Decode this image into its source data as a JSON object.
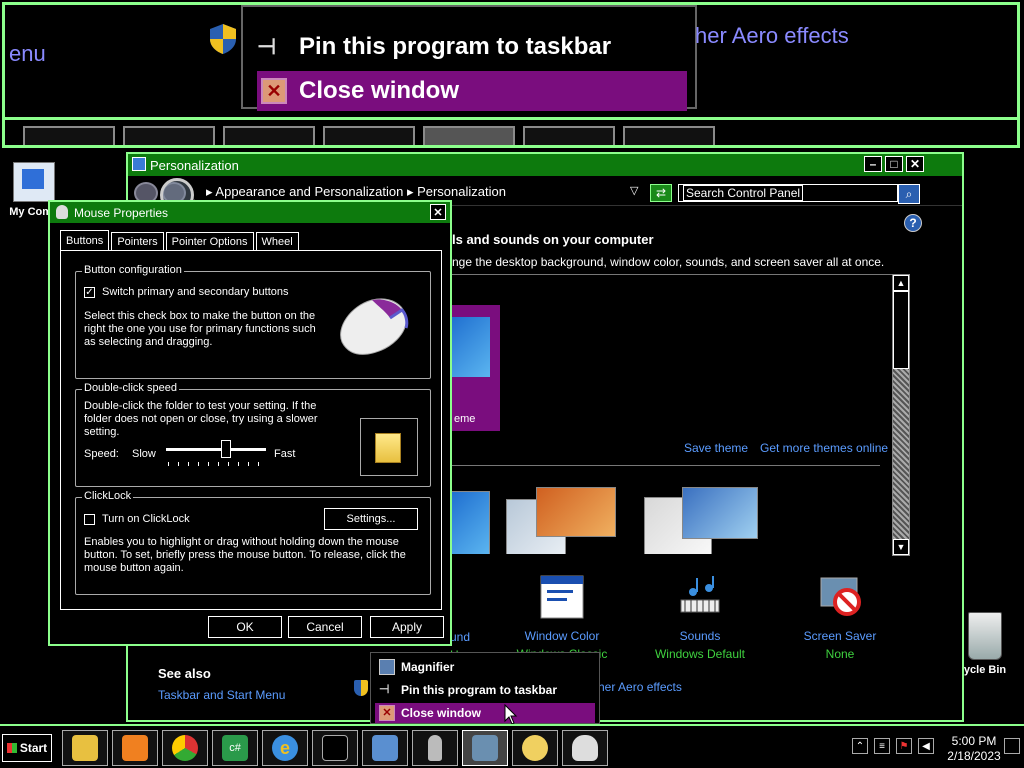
{
  "magnifier": {
    "left_text": "enu",
    "menu_pin": "Pin this program to taskbar",
    "menu_close": "Close window",
    "right_text": "her Aero effects"
  },
  "desktop": {
    "my_computer": "My Comp",
    "recycle_bin": "ycle Bin"
  },
  "personalization": {
    "title": "Personalization",
    "breadcrumb": "▸ Appearance and Personalization ▸ Personalization",
    "search_placeholder": "Search Control Panel",
    "heading": "ls and sounds on your computer",
    "subheading": "nge the desktop background, window color, sounds, and screen saver all at once.",
    "selected_theme_label": "eme",
    "save_theme": "Save theme",
    "get_more_themes": "Get more themes online",
    "bottom": [
      {
        "label": "Window Color",
        "value": "Windows Classic"
      },
      {
        "label": "Sounds",
        "value": "Windows Default"
      },
      {
        "label": "Screen Saver",
        "value": "None"
      }
    ],
    "cut_label": "und",
    "cut_value": "Harmony",
    "see_also": "See also",
    "taskbar_link": "Taskbar and Start Menu",
    "aero_link": "her Aero effects"
  },
  "mouse_dialog": {
    "title": "Mouse Properties",
    "tabs": [
      "Buttons",
      "Pointers",
      "Pointer Options",
      "Wheel"
    ],
    "button_config": {
      "title": "Button configuration",
      "switch_label": "Switch primary and secondary buttons",
      "switch_checked": true,
      "description": "Select this check box to make the button on the right the one you use for primary functions such as selecting and dragging."
    },
    "double_click": {
      "title": "Double-click speed",
      "description": "Double-click the folder to test your setting. If the folder does not open or close, try using a slower setting.",
      "speed_label": "Speed:",
      "slow": "Slow",
      "fast": "Fast",
      "speed_fraction": 0.6
    },
    "clicklock": {
      "title": "ClickLock",
      "checkbox_label": "Turn on ClickLock",
      "checked": false,
      "settings_button": "Settings...",
      "description": "Enables you to highlight or drag without holding down the mouse button. To set, briefly press the mouse button. To release, click the mouse button again."
    },
    "ok": "OK",
    "cancel": "Cancel",
    "apply": "Apply"
  },
  "context_menu": {
    "items": [
      "Magnifier",
      "Pin this program to taskbar",
      "Close window"
    ],
    "highlighted": "Close window"
  },
  "taskbar": {
    "start": "Start",
    "time": "5:00 PM",
    "date": "2/18/2023",
    "accent": "#8cff8c"
  }
}
